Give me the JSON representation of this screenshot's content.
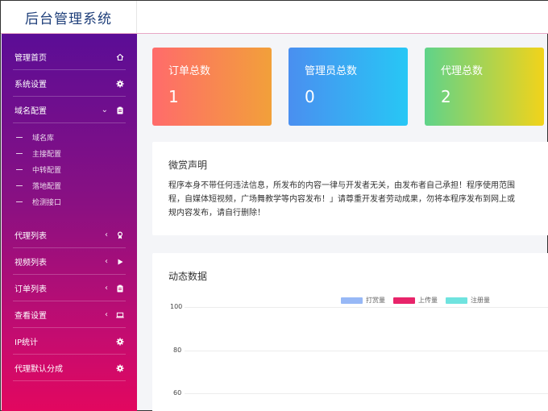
{
  "app": {
    "title": "后台管理系统"
  },
  "sidebar": {
    "items": [
      {
        "label": "管理首页",
        "icon": "home-icon"
      },
      {
        "label": "系统设置",
        "icon": "gear-icon"
      },
      {
        "label": "域名配置",
        "icon": "clipboard-icon",
        "chevron": "⌄"
      },
      {
        "label": "代理列表",
        "icon": "award-icon",
        "chevron": "‹"
      },
      {
        "label": "视频列表",
        "icon": "play-icon",
        "chevron": "‹"
      },
      {
        "label": "订单列表",
        "icon": "clipboard-icon",
        "chevron": "‹"
      },
      {
        "label": "查看设置",
        "icon": "laptop-icon",
        "chevron": "‹"
      },
      {
        "label": "IP统计",
        "icon": "gear-icon"
      },
      {
        "label": "代理默认分成",
        "icon": "gear-icon"
      }
    ],
    "subitems": [
      "域名库",
      "主接配置",
      "中转配置",
      "落地配置",
      "检测接口"
    ]
  },
  "stats": [
    {
      "label": "订单总数",
      "value": "1"
    },
    {
      "label": "管理员总数",
      "value": "0"
    },
    {
      "label": "代理总数",
      "value": "2"
    }
  ],
  "notice": {
    "title": "微赏声明",
    "lines": [
      "程序本身不带任何违法信息，所发布的内容一律与开发者无关，由发布者自己承担！程序使用范围",
      "程，自媒体短视频，广场舞教学等内容发布！」请尊重开发者劳动成果，勿将本程序发布到网上或",
      "规内容发布，请自行删除！"
    ]
  },
  "chart_data": {
    "type": "line",
    "title": "动态数据",
    "series": [
      {
        "name": "打赏量",
        "color": "#97b8f6",
        "values": []
      },
      {
        "name": "上传量",
        "color": "#e8246a",
        "values": []
      },
      {
        "name": "注册量",
        "color": "#6fe3df",
        "values": []
      }
    ],
    "y_ticks": [
      "100",
      "80",
      "60"
    ],
    "ylim": [
      60,
      100
    ]
  },
  "colors": {
    "card1": [
      "#ff6b6b",
      "#f2a03a"
    ],
    "card2": [
      "#4a8ff0",
      "#27c7f5"
    ],
    "card3": [
      "#5fd38a",
      "#f2d31a"
    ]
  }
}
